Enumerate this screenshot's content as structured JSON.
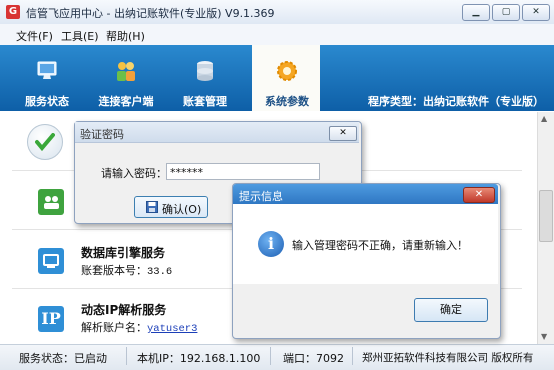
{
  "window": {
    "title": "信管飞应用中心 - 出纳记账软件(专业版) V9.1.369"
  },
  "menu": {
    "items": [
      "文件(F)",
      "工具(E)",
      "帮助(H)"
    ]
  },
  "toolbar": {
    "items": [
      {
        "label": "服务状态",
        "icon": "monitor-icon"
      },
      {
        "label": "连接客户端",
        "icon": "users-icon"
      },
      {
        "label": "账套管理",
        "icon": "database-icon"
      },
      {
        "label": "系统参数",
        "icon": "gear-icon",
        "active": true
      }
    ],
    "program_type": "程序类型：出纳记账软件（专业版）"
  },
  "services": [
    {
      "title": "数据库引擎服务",
      "detail_label": "账套版本号：",
      "detail_value": "33.6"
    },
    {
      "title": "动态IP解析服务",
      "detail_label": "解析账户名：",
      "detail_value": "yatuser3"
    }
  ],
  "status_bar": {
    "service_status": "服务状态：已启动",
    "ip": "本机IP：192.168.1.100",
    "port": "端口：7092",
    "copyright": "郑州亚拓软件科技有限公司 版权所有"
  },
  "password_dialog": {
    "title": "验证密码",
    "label": "请输入密码：",
    "value": "******",
    "ok_label": "确认(O)"
  },
  "prompt_dialog": {
    "title": "提示信息",
    "message": "输入管理密码不正确，请重新输入！",
    "confirm_label": "确定"
  },
  "colors": {
    "toolbar": "#1a70ba",
    "accent": "#2f77c3"
  }
}
